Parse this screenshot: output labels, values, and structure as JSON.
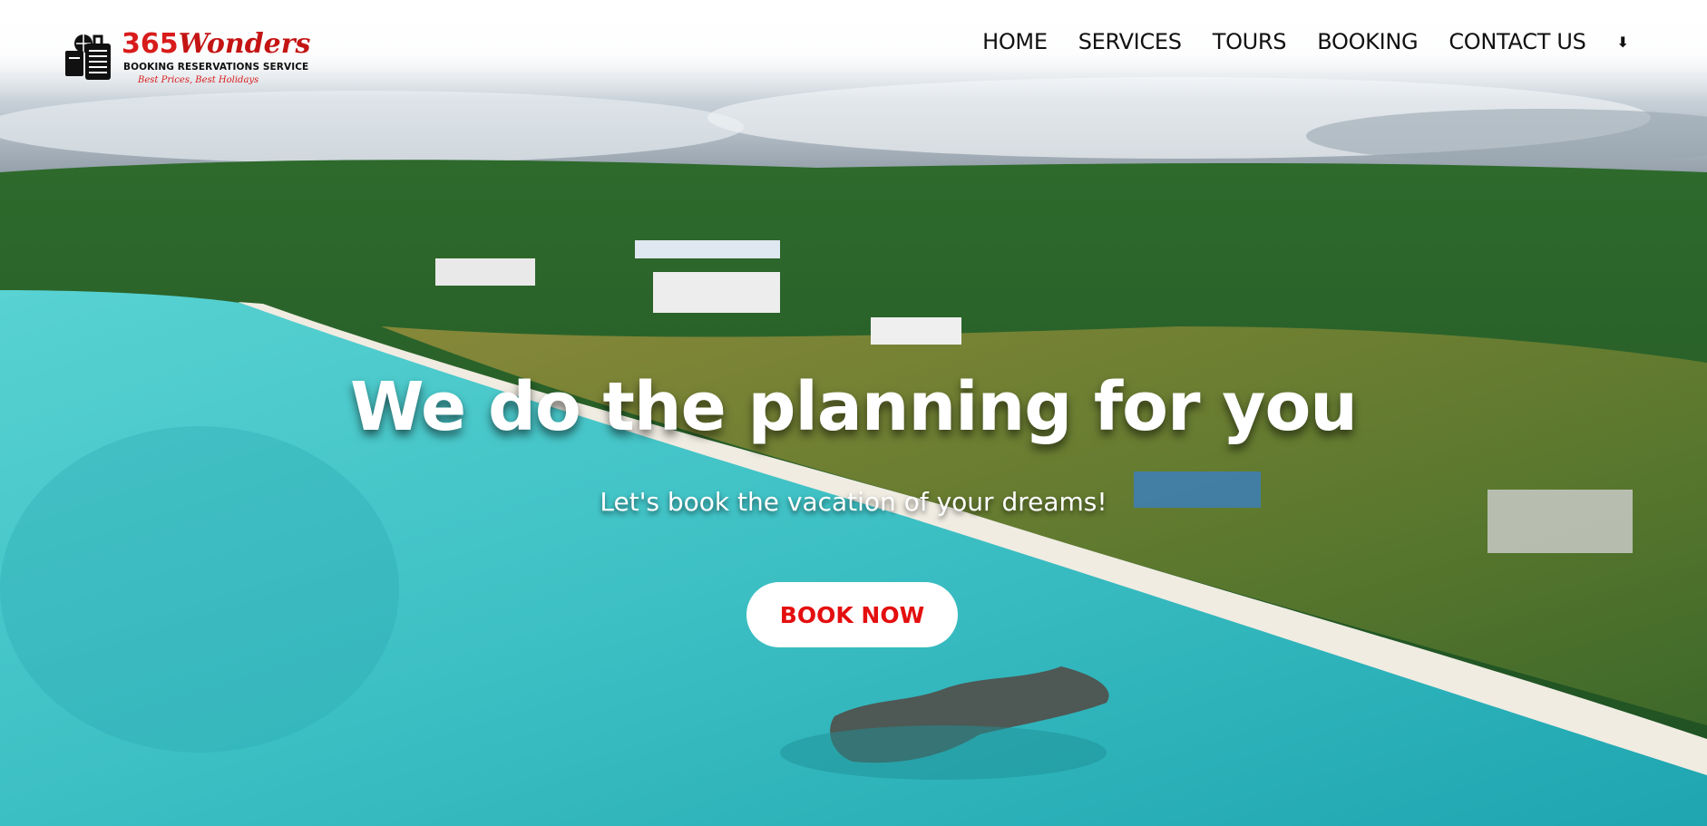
{
  "logo": {
    "number": "365",
    "word": "Wonders",
    "subtitle": "BOOKING RESERVATIONS SERVICE",
    "tagline": "Best Prices, Best Holidays",
    "icon": "luggage-globe-icon"
  },
  "nav": {
    "items": [
      {
        "label": "HOME"
      },
      {
        "label": "SERVICES"
      },
      {
        "label": "TOURS"
      },
      {
        "label": "BOOKING"
      },
      {
        "label": "CONTACT US"
      }
    ],
    "more_glyph": "⬇",
    "more_icon": "arrow-down-icon"
  },
  "hero": {
    "headline": "We do the planning for you",
    "subline": "Let's book the vacation of your dreams!",
    "cta_label": "BOOK NOW",
    "background": "aerial beach photo"
  },
  "colors": {
    "accent_red": "#e40f0f",
    "nav_text": "#111111",
    "sea": "#3fc2c4",
    "forest": "#2f6b2a"
  }
}
